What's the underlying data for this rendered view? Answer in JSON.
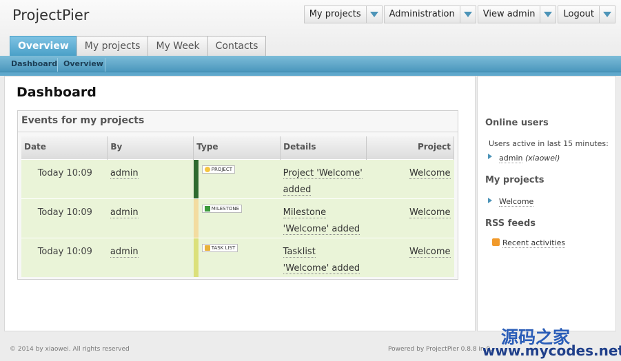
{
  "app": {
    "title": "ProjectPier"
  },
  "account_menu": [
    {
      "label": "My projects"
    },
    {
      "label": "Administration"
    },
    {
      "label": "View admin"
    },
    {
      "label": "Logout"
    }
  ],
  "tabs": [
    {
      "label": "Overview",
      "active": true
    },
    {
      "label": "My projects"
    },
    {
      "label": "My Week"
    },
    {
      "label": "Contacts"
    }
  ],
  "breadcrumb": {
    "item1": "Dashboard",
    "item2": "Overview"
  },
  "page": {
    "title": "Dashboard"
  },
  "events": {
    "title": "Events for my projects",
    "columns": {
      "date": "Date",
      "by": "By",
      "type": "Type",
      "details": "Details",
      "project": "Project"
    },
    "rows": [
      {
        "date": "Today 10:09",
        "by": "admin",
        "type": "PROJECT",
        "type_icon": "bulb-icon",
        "details": "Project 'Welcome' added",
        "project": "Welcome",
        "bar_color": "#2e6a2e"
      },
      {
        "date": "Today 10:09",
        "by": "admin",
        "type": "MILESTONE",
        "type_icon": "flag-icon",
        "details": "Milestone 'Welcome' added",
        "project": "Welcome",
        "bar_color": "#f3dca0"
      },
      {
        "date": "Today 10:09",
        "by": "admin",
        "type": "TASK LIST",
        "type_icon": "tasklist-icon",
        "details": "Tasklist 'Welcome' added",
        "project": "Welcome",
        "bar_color": "#dbe07a"
      }
    ]
  },
  "sidebar": {
    "online": {
      "title": "Online users",
      "subtitle": "Users active in last 15 minutes:",
      "user": "admin",
      "user_note": "(xiaowei)"
    },
    "projects": {
      "title": "My projects",
      "item": "Welcome"
    },
    "rss": {
      "title": "RSS feeds",
      "item": "Recent activities"
    }
  },
  "footer": {
    "left": "© 2014 by xiaowei. All rights reserved",
    "right": "Powered by ProjectPier 0.8.8 in 0."
  },
  "watermark": {
    "line1": "源码之家",
    "line2": "www.mycodes.net"
  },
  "colors": {
    "accent": "#4aa0c8",
    "row_bg": "#eaf4d8"
  }
}
